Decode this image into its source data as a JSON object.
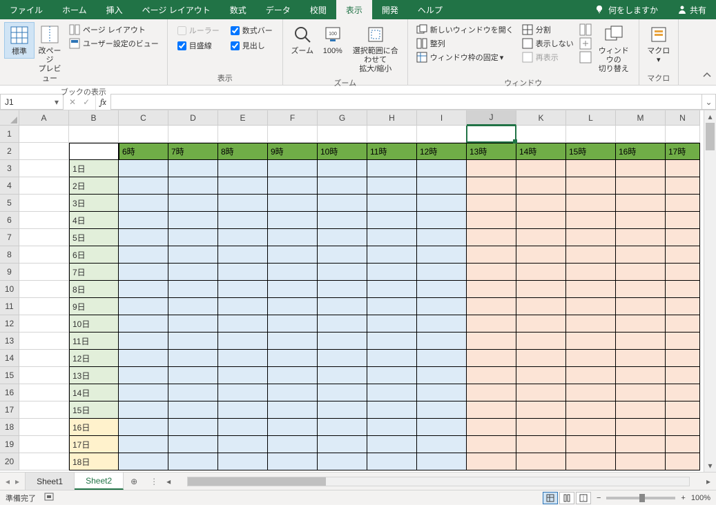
{
  "tabs": {
    "file": "ファイル",
    "home": "ホーム",
    "insert": "挿入",
    "page_layout": "ページ レイアウト",
    "formulas": "数式",
    "data": "データ",
    "review": "校閲",
    "view": "表示",
    "developer": "開発",
    "help": "ヘルプ",
    "tell_me": "何をしますか",
    "share": "共有"
  },
  "ribbon": {
    "group_view": "ブックの表示",
    "group_show": "表示",
    "group_zoom": "ズーム",
    "group_window": "ウィンドウ",
    "group_macro": "マクロ",
    "normal": "標準",
    "page_break": "改ページ\nプレビュー",
    "page_layout": "ページ レイアウト",
    "custom_views": "ユーザー設定のビュー",
    "ruler": "ルーラー",
    "formula_bar": "数式バー",
    "gridlines": "目盛線",
    "headings": "見出し",
    "zoom": "ズーム",
    "hundred": "100%",
    "zoom_selection": "選択範囲に合わせて\n拡大/縮小",
    "new_window": "新しいウィンドウを開く",
    "arrange": "整列",
    "freeze": "ウィンドウ枠の固定",
    "split": "分割",
    "hide": "表示しない",
    "unhide": "再表示",
    "switch_windows": "ウィンドウの\n切り替え",
    "macros": "マクロ"
  },
  "name_box": "J1",
  "columns": [
    "A",
    "B",
    "C",
    "D",
    "E",
    "F",
    "G",
    "H",
    "I",
    "J",
    "K",
    "L",
    "M",
    "N"
  ],
  "rows": [
    "1",
    "2",
    "3",
    "4",
    "5",
    "6",
    "7",
    "8",
    "9",
    "10",
    "11",
    "12",
    "13",
    "14",
    "15",
    "16",
    "17",
    "18",
    "19",
    "20"
  ],
  "headers_time": [
    "6時",
    "7時",
    "8時",
    "9時",
    "10時",
    "11時",
    "12時",
    "13時",
    "14時",
    "15時",
    "16時",
    "17時"
  ],
  "days": [
    "1日",
    "2日",
    "3日",
    "4日",
    "5日",
    "6日",
    "7日",
    "8日",
    "9日",
    "10日",
    "11日",
    "12日",
    "13日",
    "14日",
    "15日",
    "16日",
    "17日",
    "18日"
  ],
  "sheets": {
    "s1": "Sheet1",
    "s2": "Sheet2"
  },
  "status": {
    "ready": "準備完了",
    "zoom": "100%"
  }
}
